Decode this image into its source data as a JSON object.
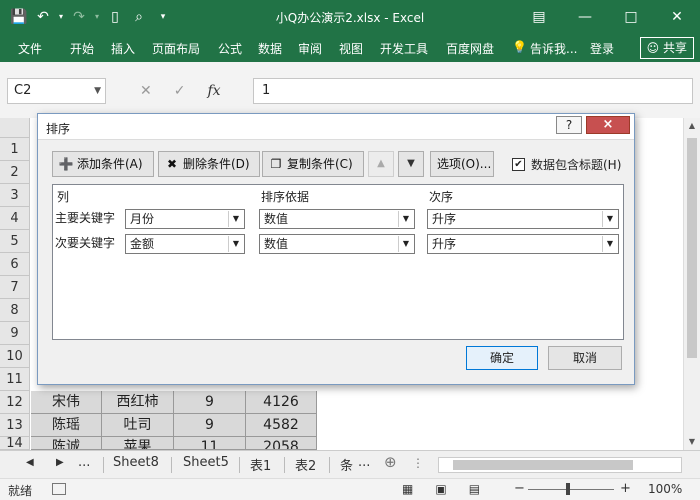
{
  "window": {
    "title": "小Q办公演示2.xlsx - Excel"
  },
  "ribbon": {
    "tabs": [
      "文件",
      "开始",
      "插入",
      "页面布局",
      "公式",
      "数据",
      "审阅",
      "视图",
      "开发工具",
      "百度网盘"
    ],
    "tell_me": "告诉我...",
    "login": "登录",
    "share": "共享"
  },
  "formula_bar": {
    "name_box": "C2",
    "formula_value": "1",
    "fx_label": "fx"
  },
  "sheet": {
    "row_numbers": [
      "1",
      "2",
      "3",
      "4",
      "5",
      "6",
      "7",
      "8",
      "9",
      "10",
      "11",
      "12",
      "13",
      "14"
    ],
    "visible_rows": [
      {
        "row": "12",
        "cells": [
          "宋伟",
          "西红柿",
          "9",
          "4126"
        ]
      },
      {
        "row": "13",
        "cells": [
          "陈瑶",
          "吐司",
          "9",
          "4582"
        ]
      },
      {
        "row": "14",
        "cells": [
          "陈诚",
          "苹果",
          "11",
          "2058"
        ]
      }
    ]
  },
  "sheet_tabs": {
    "ellipsis": "...",
    "tabs": [
      "Sheet8",
      "Sheet5",
      "表1",
      "表2",
      "条"
    ],
    "more": "..."
  },
  "status_bar": {
    "ready": "就绪",
    "zoom": "100%"
  },
  "sort_dialog": {
    "title": "排序",
    "help": "?",
    "close": "×",
    "add_level": "添加条件(A)",
    "delete_level": "删除条件(D)",
    "copy_level": "复制条件(C)",
    "options": "选项(O)...",
    "has_headers": "数据包含标题(H)",
    "has_headers_checked": true,
    "column_headers": {
      "column": "列",
      "sort_on": "排序依据",
      "order": "次序"
    },
    "levels": [
      {
        "label": "主要关键字",
        "column": "月份",
        "sort_on": "数值",
        "order": "升序"
      },
      {
        "label": "次要关键字",
        "column": "金额",
        "sort_on": "数值",
        "order": "升序"
      }
    ],
    "ok": "确定",
    "cancel": "取消"
  }
}
